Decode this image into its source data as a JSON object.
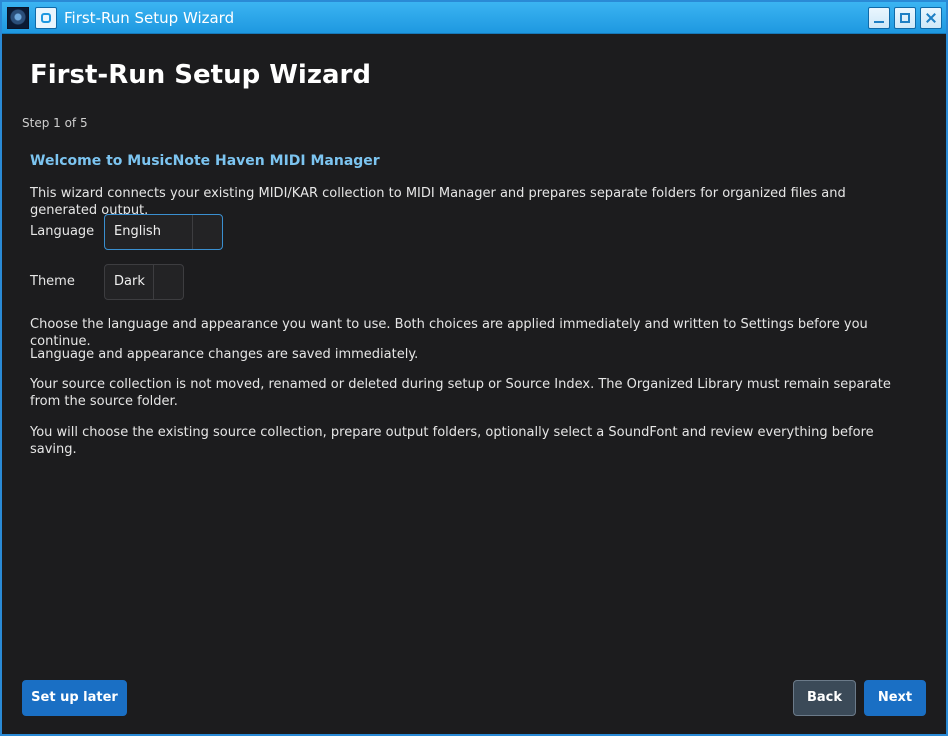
{
  "window": {
    "title": "First-Run Setup Wizard"
  },
  "wizard": {
    "title": "First-Run Setup Wizard",
    "step": "Step 1 of 5",
    "heading": "Welcome to MusicNote Haven MIDI Manager",
    "intro": "This wizard connects your existing MIDI/KAR collection to MIDI Manager and prepares separate folders for organized files and generated output.",
    "language": {
      "label": "Language",
      "value": "English"
    },
    "theme": {
      "label": "Theme",
      "value": "Dark"
    },
    "paragraphs": [
      "Choose the language and appearance you want to use. Both choices are applied immediately and written to Settings before you continue.",
      "Language and appearance changes are saved immediately.",
      "Your source collection is not moved, renamed or deleted during setup or Source Index. The Organized Library must remain separate from the source folder.",
      "You will choose the existing source collection, prepare output folders, optionally select a SoundFont and review everything before saving."
    ]
  },
  "buttons": {
    "later": "Set up later",
    "back": "Back",
    "next": "Next"
  },
  "colors": {
    "accent": "#2a8ad6",
    "heading": "#7cc4f0",
    "primary_button": "#1a6fc4",
    "background": "#1c1c1e"
  }
}
